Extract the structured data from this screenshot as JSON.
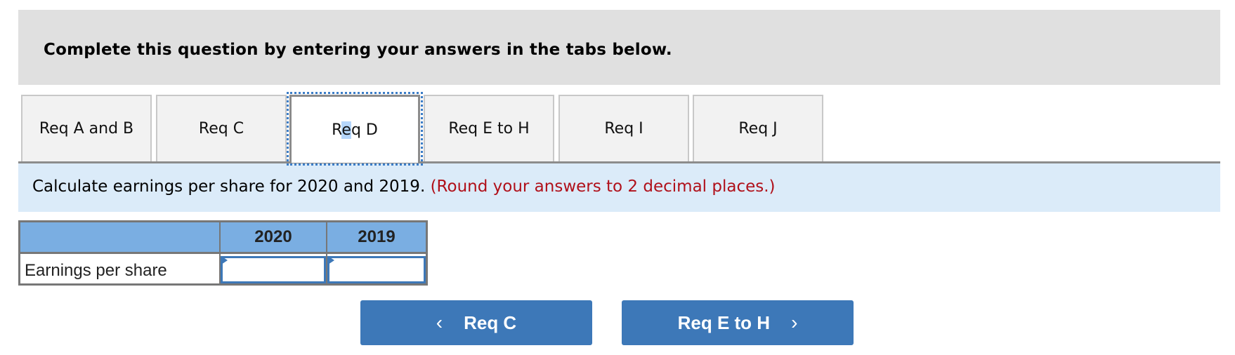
{
  "instructions": {
    "text": "Complete this question by entering your answers in the tabs below."
  },
  "tabs": [
    {
      "label": "Req A and B",
      "active": false
    },
    {
      "label": "Req C",
      "active": false
    },
    {
      "label": "Req D",
      "active": true
    },
    {
      "label": "Req E to H",
      "active": false
    },
    {
      "label": "Req I",
      "active": false
    },
    {
      "label": "Req J",
      "active": false
    }
  ],
  "active_tab_label_parts": {
    "before": "R",
    "selected": "e",
    "after": "q D"
  },
  "info": {
    "prompt": "Calculate earnings per share for 2020 and 2019.",
    "note": "(Round your answers to 2 decimal places.)"
  },
  "table": {
    "columns": [
      "",
      "2020",
      "2019"
    ],
    "rows": [
      {
        "label": "Earnings per share",
        "values": [
          "",
          ""
        ]
      }
    ]
  },
  "navigation": {
    "prev_label": "Req C",
    "next_label": "Req E to H",
    "prev_icon": "chevron-left-icon",
    "next_icon": "chevron-right-icon"
  },
  "colors": {
    "header_gray": "#e0e0e0",
    "info_blue": "#dbebf9",
    "note_red": "#b0101a",
    "table_header_blue": "#7aaee2",
    "button_blue": "#3d78b8",
    "focus_outline": "#3b7cc6"
  }
}
